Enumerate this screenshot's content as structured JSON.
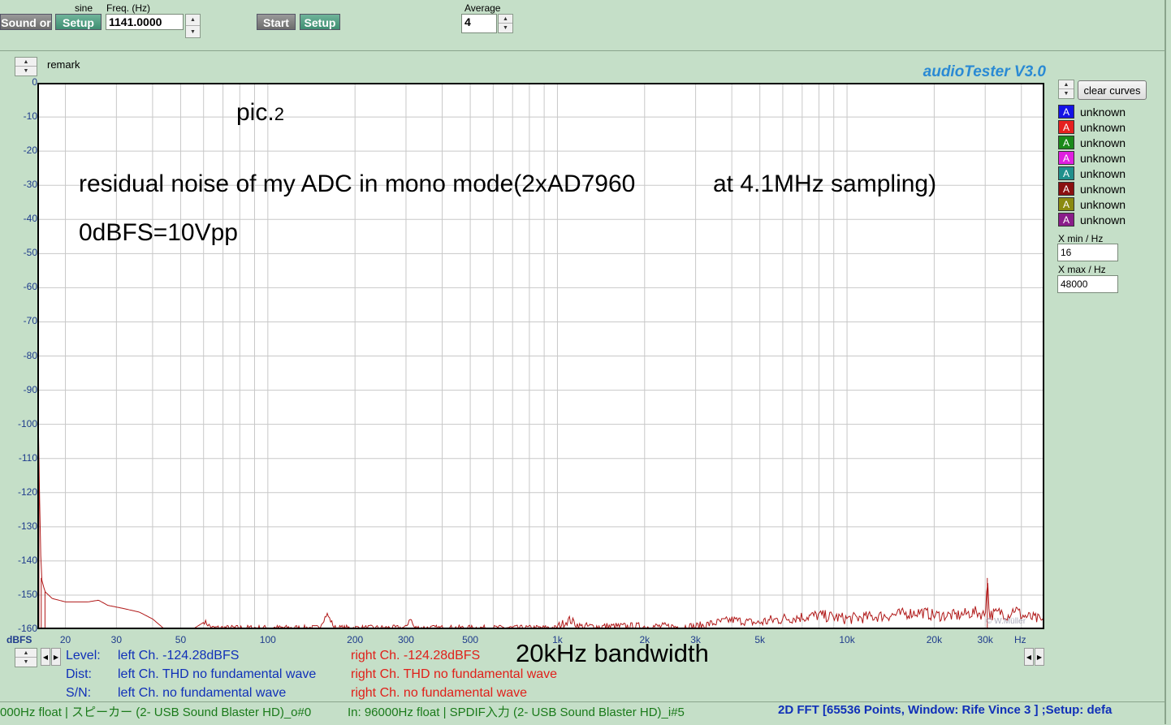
{
  "toolbar": {
    "sound_btn": "Sound or",
    "sine_label": "sine",
    "setup1": "Setup",
    "freq_label": "Freq. (Hz)",
    "freq_value": "1141.0000",
    "start_btn": "Start",
    "setup2": "Setup",
    "average_label": "Average",
    "average_value": "4"
  },
  "remark_label": "remark",
  "app_title": "audioTester  V3.0",
  "annotations": {
    "pic": "pic.",
    "pic_num": "2",
    "line1": "residual noise of my ADC in mono mode(2xAD7960",
    "line1b": "at 4.1MHz sampling)",
    "line2": "0dBFS=10Vpp",
    "bandwidth": "20kHz bandwidth",
    "copyright": "© W.Müller"
  },
  "side": {
    "clear_curves": "clear curves",
    "legend": [
      {
        "icon": "A",
        "color": "#1414e6",
        "label": "unknown"
      },
      {
        "icon": "A",
        "color": "#e62020",
        "label": "unknown"
      },
      {
        "icon": "A",
        "color": "#1a8a1a",
        "label": "unknown"
      },
      {
        "icon": "A",
        "color": "#e020e0",
        "label": "unknown"
      },
      {
        "icon": "A",
        "color": "#20908c",
        "label": "unknown"
      },
      {
        "icon": "A",
        "color": "#8a1010",
        "label": "unknown"
      },
      {
        "icon": "A",
        "color": "#8a8a10",
        "label": "unknown"
      },
      {
        "icon": "A",
        "color": "#8a1c8a",
        "label": "unknown"
      }
    ],
    "xmin_label": "X min / Hz",
    "xmin_value": "16",
    "xmax_label": "X max / Hz",
    "xmax_value": "48000"
  },
  "chart_data": {
    "type": "line",
    "title": "",
    "ylabel": "dBFS",
    "xlabel": "Hz",
    "xscale": "log",
    "xlim": [
      16,
      48000
    ],
    "ylim": [
      -160,
      0
    ],
    "y_ticks": [
      0,
      -10,
      -20,
      -30,
      -40,
      -50,
      -60,
      -70,
      -80,
      -90,
      -100,
      -110,
      -120,
      -130,
      -140,
      -150,
      -160
    ],
    "x_ticks": [
      {
        "v": 20,
        "t": "20"
      },
      {
        "v": 30,
        "t": "30"
      },
      {
        "v": 50,
        "t": "50"
      },
      {
        "v": 100,
        "t": "100"
      },
      {
        "v": 200,
        "t": "200"
      },
      {
        "v": 300,
        "t": "300"
      },
      {
        "v": 500,
        "t": "500"
      },
      {
        "v": 1000,
        "t": "1k"
      },
      {
        "v": 2000,
        "t": "2k"
      },
      {
        "v": 3000,
        "t": "3k"
      },
      {
        "v": 5000,
        "t": "5k"
      },
      {
        "v": 10000,
        "t": "10k"
      },
      {
        "v": 20000,
        "t": "20k"
      },
      {
        "v": 30000,
        "t": "30k"
      }
    ],
    "grid": true,
    "series": [
      {
        "color": "#b01818",
        "points": [
          [
            16,
            -76
          ],
          [
            16.2,
            -112
          ],
          [
            16.5,
            -145
          ],
          [
            17,
            -149
          ],
          [
            18,
            -151
          ],
          [
            20,
            -152
          ],
          [
            24,
            -152
          ],
          [
            26,
            -151.5
          ],
          [
            28,
            -153
          ],
          [
            32,
            -154
          ],
          [
            36,
            -155
          ],
          [
            40,
            -157
          ],
          [
            44,
            -160
          ],
          [
            55,
            -160
          ],
          [
            60,
            -158
          ],
          [
            64,
            -160
          ],
          [
            150,
            -160
          ],
          [
            160,
            -156
          ],
          [
            170,
            -160
          ],
          [
            300,
            -160
          ],
          [
            310,
            -157
          ],
          [
            320,
            -160
          ],
          [
            1000,
            -160
          ],
          [
            1100,
            -158
          ],
          [
            1200,
            -160
          ],
          [
            3000,
            -160
          ],
          [
            4000,
            -158
          ],
          [
            5000,
            -159
          ],
          [
            6000,
            -158
          ],
          [
            8000,
            -157
          ],
          [
            10000,
            -158
          ],
          [
            14000,
            -157
          ],
          [
            18000,
            -156
          ],
          [
            20000,
            -157
          ],
          [
            24000,
            -157
          ],
          [
            28000,
            -156
          ],
          [
            30000,
            -157
          ],
          [
            30500,
            -145
          ],
          [
            31000,
            -157
          ],
          [
            34000,
            -156
          ],
          [
            36000,
            -157
          ],
          [
            38000,
            -155
          ],
          [
            40000,
            -157
          ],
          [
            45000,
            -158
          ],
          [
            48000,
            -159
          ]
        ]
      }
    ]
  },
  "bottom": {
    "dbfs": "dBFS",
    "hz": "Hz",
    "level_label": "Level:",
    "level_left": "left Ch. -124.28dBFS",
    "level_right": "right Ch. -124.28dBFS",
    "dist_label": "Dist:",
    "dist_left": "left Ch. THD no fundamental wave",
    "dist_right": "right Ch. THD no fundamental wave",
    "sn_label": "S/N:",
    "sn_left": "left Ch.  no fundamental wave",
    "sn_right": "right Ch.  no fundamental wave"
  },
  "status": {
    "out": "000Hz float  | スピーカー (2- USB Sound Blaster HD)_o#0",
    "in": "In: 96000Hz float  | SPDIF入力 (2- USB Sound Blaster HD)_i#5",
    "fft": "2D FFT [65536 Points, Window: Rife Vince 3 ]  ;Setup:  defa"
  }
}
